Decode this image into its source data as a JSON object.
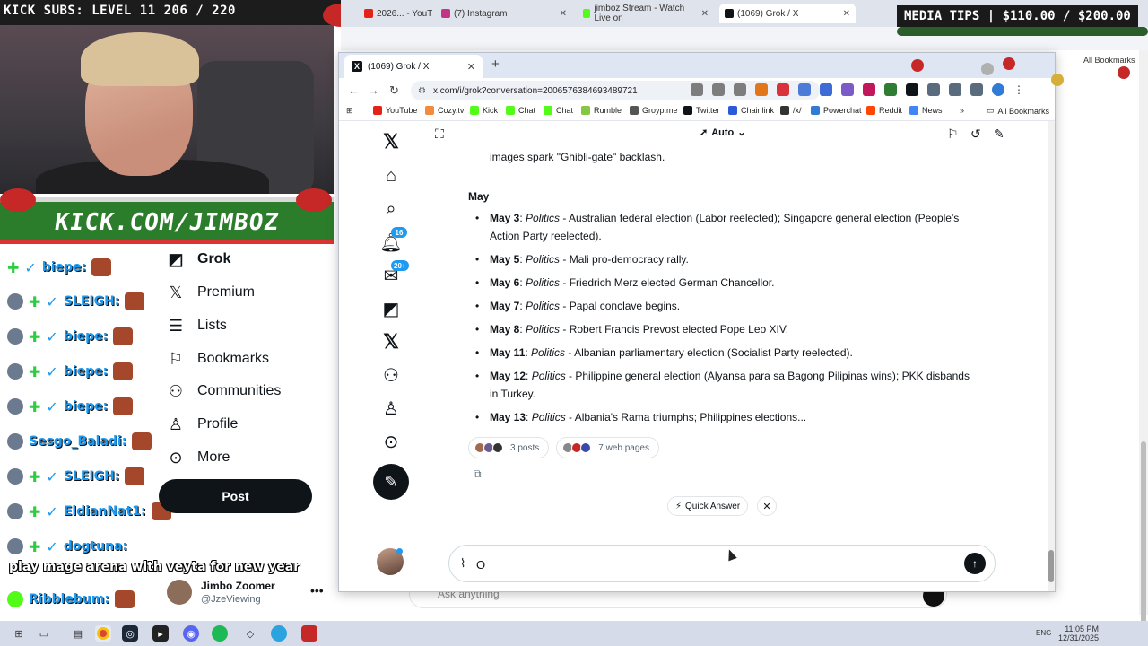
{
  "overlay": {
    "subs_text": "KICK SUBS: LEVEL 11 206 / 220",
    "banner_text": "KICK.COM/JIMBOZ",
    "media_tips": "MEDIA TIPS | $110.00 / $200.00",
    "chat": [
      {
        "name": "biepe:"
      },
      {
        "name": "SLEIGH:"
      },
      {
        "name": "biepe:"
      },
      {
        "name": "biepe:"
      },
      {
        "name": "biepe:"
      },
      {
        "name": "Sesgo_Baladi:"
      },
      {
        "name": "SLEIGH:"
      },
      {
        "name": "EldianNat1:"
      },
      {
        "name": "dogtuna:"
      },
      {
        "name": "Ribblebum:"
      }
    ],
    "chat_message": "play mage arena with veyta for new year"
  },
  "background_window": {
    "tabs": [
      {
        "label": "2026... - YouT",
        "color": "#e62117"
      },
      {
        "label": "(7) Instagram",
        "color": "#c13584"
      },
      {
        "label": "jimboz Stream - Watch Live on",
        "color": "#53fc18"
      },
      {
        "label": "(1069) Grok / X",
        "color": "#0f1419"
      }
    ],
    "nav": [
      {
        "label": "Grok",
        "icon": "grok-icon",
        "glyph": "◩"
      },
      {
        "label": "Premium",
        "icon": "x-icon",
        "glyph": "𝕏"
      },
      {
        "label": "Lists",
        "icon": "list-icon",
        "glyph": "☰"
      },
      {
        "label": "Bookmarks",
        "icon": "bookmark-icon",
        "glyph": "⚐"
      },
      {
        "label": "Communities",
        "icon": "communities-icon",
        "glyph": "⚇"
      },
      {
        "label": "Profile",
        "icon": "profile-icon",
        "glyph": "♙"
      },
      {
        "label": "More",
        "icon": "more-icon",
        "glyph": "⊙"
      }
    ],
    "post_label": "Post",
    "profile_name": "Jimbo Zoomer",
    "profile_handle": "@JzeViewing",
    "ask_placeholder": "Ask anything",
    "bookmarks_label": "All Bookmarks"
  },
  "window": {
    "tab_title": "(1069) Grok / X",
    "url": "x.com/i/grok?conversation=2006576384693489721",
    "bookmarks": [
      {
        "label": "YouTube",
        "color": "#e62117"
      },
      {
        "label": "Cozy.tv",
        "color": "#f28b3b"
      },
      {
        "label": "Kick",
        "color": "#53fc18"
      },
      {
        "label": "Chat",
        "color": "#53fc18"
      },
      {
        "label": "Chat",
        "color": "#53fc18"
      },
      {
        "label": "Rumble",
        "color": "#85c742"
      },
      {
        "label": "Groyp.me",
        "color": "#555555"
      },
      {
        "label": "Twitter",
        "color": "#0f1419"
      },
      {
        "label": "Chainlink",
        "color": "#2a5ada"
      },
      {
        "label": "/x/",
        "color": "#333333"
      },
      {
        "label": "Powerchat",
        "color": "#2f7bd6"
      },
      {
        "label": "Reddit",
        "color": "#ff4500"
      },
      {
        "label": "News",
        "color": "#4285f4"
      }
    ],
    "all_bookmarks": "All Bookmarks"
  },
  "x_nav": {
    "notifications_badge": "16",
    "messages_badge": "20+"
  },
  "grok": {
    "mode": "Auto",
    "cut_line": "images spark \"Ghibli-gate\" backlash.",
    "month": "May",
    "items": [
      {
        "date": "May 3",
        "category": "Politics",
        "text": " - Australian federal election (Labor reelected); Singapore general election (People's Action Party reelected)."
      },
      {
        "date": "May 5",
        "category": "Politics",
        "text": " - Mali pro-democracy rally."
      },
      {
        "date": "May 6",
        "category": "Politics",
        "text": " - Friedrich Merz elected German Chancellor."
      },
      {
        "date": "May 7",
        "category": "Politics",
        "text": " - Papal conclave begins."
      },
      {
        "date": "May 8",
        "category": "Politics",
        "text": " - Robert Francis Prevost elected Pope Leo XIV."
      },
      {
        "date": "May 11",
        "category": "Politics",
        "text": " - Albanian parliamentary election (Socialist Party reelected)."
      },
      {
        "date": "May 12",
        "category": "Politics",
        "text": " - Philippine general election (Alyansa para sa Bagong Pilipinas wins); PKK disbands in Turkey."
      },
      {
        "date": "May 13",
        "category": "Politics",
        "text": " - Albania's Rama triumphs; Philippines elections..."
      }
    ],
    "posts_label": "3 posts",
    "web_label": "7 web pages",
    "quick_answer": "Quick Answer",
    "composer_value": "O"
  },
  "taskbar": {
    "lang": "ENG",
    "time": "11:05 PM",
    "date": "12/31/2025"
  }
}
